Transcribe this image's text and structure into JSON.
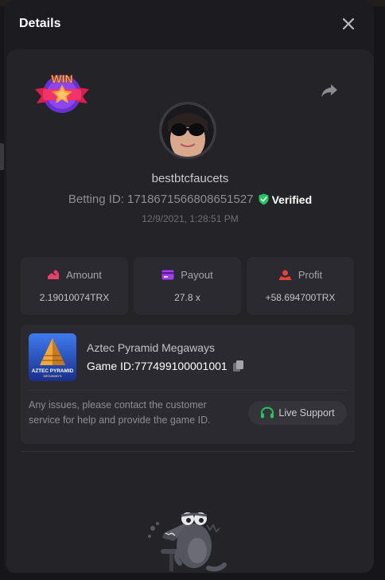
{
  "modal": {
    "title": "Details",
    "close_icon": "close-icon"
  },
  "header_badge": {
    "text": "WIN",
    "icon": "win-badge-icon"
  },
  "share": {
    "icon": "share-icon"
  },
  "user": {
    "username": "bestbtcfaucets",
    "betting_id": "Betting ID: 1718671566808651527",
    "verified_label": "Verified",
    "verified_color": "#22c55e",
    "timestamp": "12/9/2021, 1:28:51 PM"
  },
  "stats": [
    {
      "label": "Amount",
      "value": "2.19010074TRX",
      "icon": "amount-icon",
      "color": "#e8406a"
    },
    {
      "label": "Payout",
      "value": "27.8 x",
      "icon": "payout-icon",
      "color": "#a23ff0"
    },
    {
      "label": "Profit",
      "value": "+58.694700TRX",
      "icon": "profit-icon",
      "color": "#e8403a"
    }
  ],
  "game": {
    "name": "Aztec Pyramid Megaways",
    "game_id": "Game ID:777499100001001",
    "thumb_title": "AZTEC PYRAMID",
    "thumb_subtitle": "MEGAWAYS"
  },
  "support": {
    "issue_text": "Any issues, please contact the customer service for help and provide the game ID.",
    "button_label": "Live Support",
    "icon": "headset-icon",
    "icon_color": "#22c55e"
  }
}
